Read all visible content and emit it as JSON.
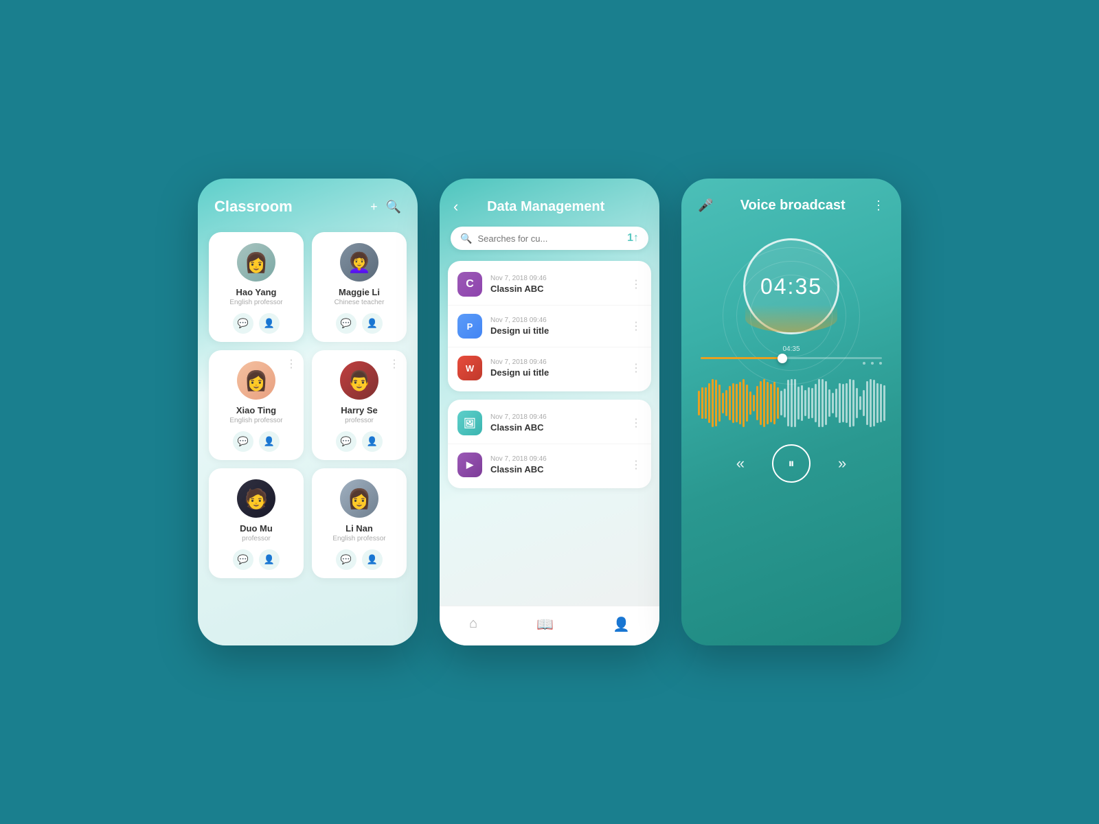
{
  "app": {
    "background": "#1a7f8e"
  },
  "phone1": {
    "title": "Classroom",
    "persons": [
      {
        "id": "hao-yang",
        "name": "Hao Yang",
        "role": "English professor",
        "avatar": "hao"
      },
      {
        "id": "maggie-li",
        "name": "Maggie Li",
        "role": "Chinese teacher",
        "avatar": "maggie"
      },
      {
        "id": "xiao-ting",
        "name": "Xiao Ting",
        "role": "English professor",
        "avatar": "xiao"
      },
      {
        "id": "harry-se",
        "name": "Harry Se",
        "role": "professor",
        "avatar": "harry"
      },
      {
        "id": "duo-mu",
        "name": "Duo Mu",
        "role": "professor",
        "avatar": "duo"
      },
      {
        "id": "li-nan",
        "name": "Li Nan",
        "role": "English professor",
        "avatar": "linan"
      }
    ],
    "add_label": "+",
    "search_label": "🔍"
  },
  "phone2": {
    "title": "Data Management",
    "back_label": "‹",
    "search_placeholder": "Searches for cu...",
    "filter_label": "1↑",
    "file_groups": [
      {
        "files": [
          {
            "id": "classin-abc-1",
            "date": "Nov 7, 2018 09:46",
            "name": "Classin ABC",
            "type": "purple",
            "icon_letter": "C"
          },
          {
            "id": "design-ui-1",
            "date": "Nov 7, 2018 09:46",
            "name": "Design ui title",
            "type": "blue-p",
            "icon_letter": "P"
          },
          {
            "id": "design-ui-2",
            "date": "Nov 7, 2018 09:46",
            "name": "Design ui title",
            "type": "red-w",
            "icon_letter": "W"
          }
        ]
      },
      {
        "files": [
          {
            "id": "classin-abc-2",
            "date": "Nov 7, 2018 09:46",
            "name": "Classin ABC",
            "type": "teal",
            "icon_letter": "🖼"
          },
          {
            "id": "classin-abc-3",
            "date": "Nov 7, 2018 09:46",
            "name": "Classin ABC",
            "type": "purple2",
            "icon_letter": "▶"
          }
        ]
      }
    ],
    "nav": {
      "home": "⌂",
      "book": "📖",
      "person": "👤"
    }
  },
  "phone3": {
    "title": "Voice broadcast",
    "mic_label": "🎤",
    "more_label": "⋮",
    "timer": "04:35",
    "time_position": "04:35",
    "controls": {
      "rewind": "«",
      "pause": "⏸",
      "forward": "»"
    }
  }
}
